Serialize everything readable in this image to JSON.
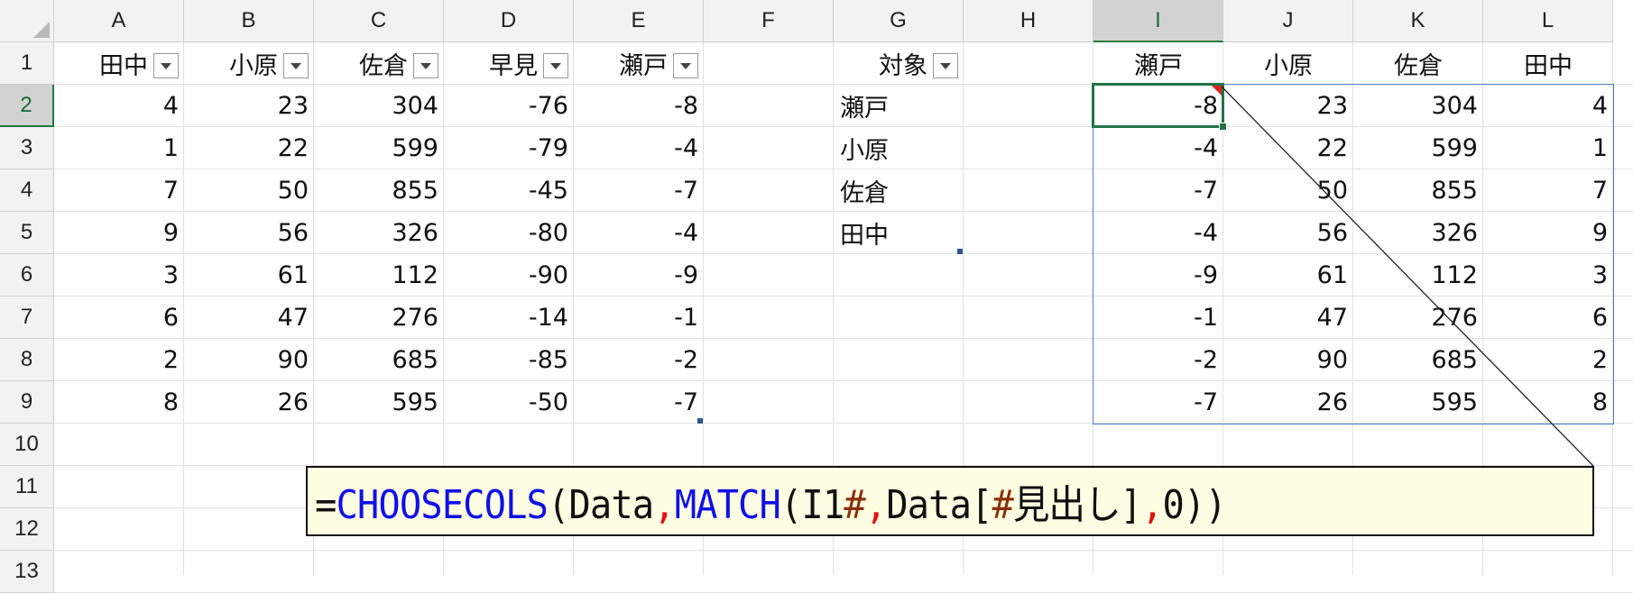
{
  "columns": [
    "A",
    "B",
    "C",
    "D",
    "E",
    "F",
    "G",
    "H",
    "I",
    "J",
    "K",
    "L"
  ],
  "rows": [
    "1",
    "2",
    "3",
    "4",
    "5",
    "6",
    "7",
    "8",
    "9",
    "10",
    "11",
    "12",
    "13"
  ],
  "selected_column": "I",
  "selected_row": "2",
  "data_table": {
    "headers": [
      "田中",
      "小原",
      "佐倉",
      "早見",
      "瀬戸"
    ],
    "rows": [
      [
        "4",
        "23",
        "304",
        "-76",
        "-8"
      ],
      [
        "1",
        "22",
        "599",
        "-79",
        "-4"
      ],
      [
        "7",
        "50",
        "855",
        "-45",
        "-7"
      ],
      [
        "9",
        "56",
        "326",
        "-80",
        "-4"
      ],
      [
        "3",
        "61",
        "112",
        "-90",
        "-9"
      ],
      [
        "6",
        "47",
        "276",
        "-14",
        "-1"
      ],
      [
        "2",
        "90",
        "685",
        "-85",
        "-2"
      ],
      [
        "8",
        "26",
        "595",
        "-50",
        "-7"
      ]
    ]
  },
  "target_table": {
    "header": "対象",
    "values": [
      "瀬戸",
      "小原",
      "佐倉",
      "田中"
    ]
  },
  "result": {
    "headers": [
      "瀬戸",
      "小原",
      "佐倉",
      "田中"
    ],
    "rows": [
      [
        "-8",
        "23",
        "304",
        "4"
      ],
      [
        "-4",
        "22",
        "599",
        "1"
      ],
      [
        "-7",
        "50",
        "855",
        "7"
      ],
      [
        "-4",
        "56",
        "326",
        "9"
      ],
      [
        "-9",
        "61",
        "112",
        "3"
      ],
      [
        "-1",
        "47",
        "276",
        "6"
      ],
      [
        "-2",
        "90",
        "685",
        "2"
      ],
      [
        "-7",
        "26",
        "595",
        "8"
      ]
    ]
  },
  "formula_callout": {
    "parts": [
      {
        "text": "=",
        "color": "black"
      },
      {
        "text": "CHOOSECOLS",
        "color": "blue"
      },
      {
        "text": "(Data",
        "color": "black"
      },
      {
        "text": ",",
        "color": "red"
      },
      {
        "text": "MATCH",
        "color": "blue"
      },
      {
        "text": "(I1",
        "color": "black"
      },
      {
        "text": "#",
        "color": "brown"
      },
      {
        "text": ",",
        "color": "red"
      },
      {
        "text": "Data[",
        "color": "black"
      },
      {
        "text": "#",
        "color": "brown"
      },
      {
        "text": "見出し]",
        "color": "black"
      },
      {
        "text": ",",
        "color": "red"
      },
      {
        "text": "0))",
        "color": "black"
      }
    ]
  },
  "colors": {
    "selection": "#217346",
    "spill_border": "#4a7bc8",
    "function_blue": "#1010e8",
    "separator_red": "#e01010",
    "hash_brown": "#8a2e05",
    "callout_bg": "#fffee2",
    "comment_indicator": "#e02020"
  }
}
